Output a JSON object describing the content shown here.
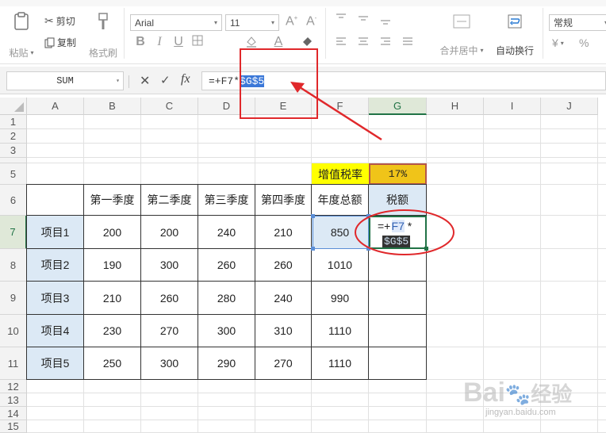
{
  "ribbon": {
    "paste": "粘贴",
    "cut": "剪切",
    "copy": "复制",
    "format_painter": "格式刷",
    "font_name": "Arial",
    "font_size": "11",
    "merge_center": "合并居中",
    "wrap_text": "自动换行",
    "number_format": "常规",
    "currency": "¥",
    "percent": "%"
  },
  "formula_bar": {
    "name_box": "SUM",
    "fx": "fx",
    "formula_prefix": "=+F7*",
    "formula_selected": "$G$5"
  },
  "columns": [
    "A",
    "B",
    "C",
    "D",
    "E",
    "F",
    "G",
    "H",
    "I",
    "J"
  ],
  "rows": [
    "1",
    "2",
    "3",
    "4",
    "5",
    "6",
    "7",
    "8",
    "9",
    "10",
    "11",
    "12",
    "13",
    "14",
    "15"
  ],
  "sheet": {
    "tax_rate_label": "增值税率",
    "tax_rate_value": "17%",
    "headers": [
      "第一季度",
      "第二季度",
      "第三季度",
      "第四季度",
      "年度总额",
      "税额"
    ],
    "data": [
      {
        "name": "项目1",
        "q": [
          "200",
          "200",
          "240",
          "210"
        ],
        "total": "850"
      },
      {
        "name": "项目2",
        "q": [
          "190",
          "300",
          "260",
          "260"
        ],
        "total": "1010"
      },
      {
        "name": "项目3",
        "q": [
          "210",
          "260",
          "280",
          "240"
        ],
        "total": "990"
      },
      {
        "name": "项目4",
        "q": [
          "230",
          "270",
          "300",
          "310"
        ],
        "total": "1110"
      },
      {
        "name": "项目5",
        "q": [
          "250",
          "300",
          "290",
          "270"
        ],
        "total": "1110"
      }
    ],
    "edit_cell_line1_prefix": "=+",
    "edit_cell_line1_ref": "F7",
    "edit_cell_line1_op": "*",
    "edit_cell_line2": "$G$5"
  },
  "watermark": {
    "brand": "Bai",
    "brand_cn": "经验",
    "url": "jingyan.baidu.com"
  },
  "colors": {
    "yellow_label": "#ffff00",
    "tax_rate_fill": "#f0c419",
    "header_blue": "#dce9f5",
    "annotation_red": "#e0282b"
  }
}
